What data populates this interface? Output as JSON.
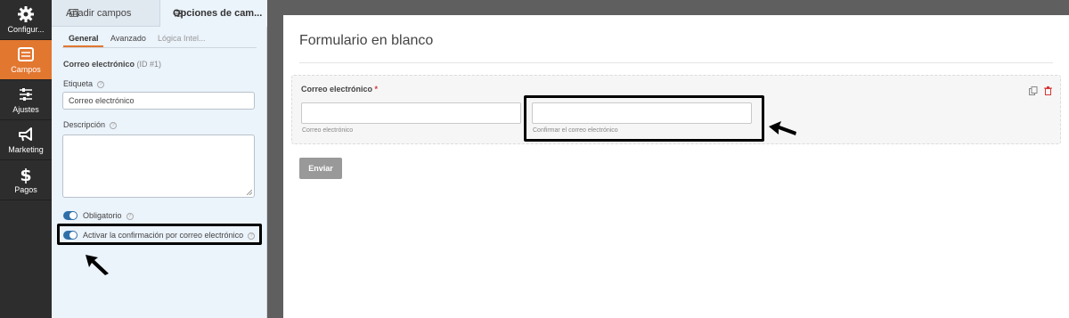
{
  "nav": {
    "items": [
      {
        "label": "Configur...",
        "icon": "gear-icon",
        "active": false
      },
      {
        "label": "Campos",
        "icon": "fields-icon",
        "active": true
      },
      {
        "label": "Ajustes",
        "icon": "sliders-icon",
        "active": false
      },
      {
        "label": "Marketing",
        "icon": "megaphone-icon",
        "active": false
      },
      {
        "label": "Pagos",
        "icon": "dollar-icon",
        "active": false
      }
    ]
  },
  "panel": {
    "tabs": [
      {
        "label": "Añadir campos",
        "icon": "list-icon"
      },
      {
        "label": "Opciones de cam...",
        "icon": "sliders-icon",
        "active": true
      }
    ],
    "subtabs": [
      "General",
      "Avanzado",
      "Lógica Intel..."
    ],
    "field_title": "Correo electrónico",
    "field_id": "(ID #1)",
    "label_caption": "Etiqueta",
    "label_value": "Correo electrónico",
    "description_caption": "Descripción",
    "toggles": [
      {
        "label": "Obligatorio",
        "on": true
      },
      {
        "label": "Activar la confirmación por correo electrónico",
        "on": true
      }
    ]
  },
  "builder": {
    "title": "Formulario en blanco",
    "field_label": "Correo electrónico",
    "required_mark": "*",
    "primary_sublabel": "Correo electrónico",
    "confirm_sublabel": "Confirmar el correo electrónico",
    "submit_label": "Enviar"
  },
  "colors": {
    "accent": "#e27730",
    "toggle": "#2f6fa8",
    "nav_bg": "#2d2d2d",
    "panel_bg": "#ebf3fb",
    "required": "#d63637"
  }
}
